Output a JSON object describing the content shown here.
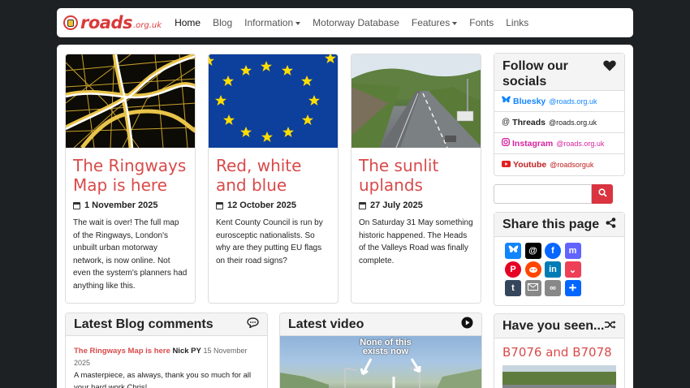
{
  "navbar": {
    "logo_text": "roads",
    "logo_suffix": ".org.uk",
    "items": [
      {
        "label": "Home",
        "active": true,
        "dropdown": false
      },
      {
        "label": "Blog",
        "active": false,
        "dropdown": false
      },
      {
        "label": "Information",
        "active": false,
        "dropdown": true
      },
      {
        "label": "Motorway Database",
        "active": false,
        "dropdown": false
      },
      {
        "label": "Features",
        "active": false,
        "dropdown": true
      },
      {
        "label": "Fonts",
        "active": false,
        "dropdown": false
      },
      {
        "label": "Links",
        "active": false,
        "dropdown": false
      }
    ]
  },
  "cards": [
    {
      "title": "The Ringways Map is here",
      "date": "1 November 2025",
      "text": "The wait is over! The full map of the Ringways, London's unbuilt urban motorway network, is now online. Not even the system's planners had anything like this."
    },
    {
      "title": "Red, white and blue",
      "date": "12 October 2025",
      "text": "Kent County Council is run by eurosceptic nationalists. So why are they putting EU flags on their road signs?"
    },
    {
      "title": "The sunlit uplands",
      "date": "27 July 2025",
      "text": "On Saturday 31 May something historic happened. The Heads of the Valleys Road was finally complete."
    }
  ],
  "socials": {
    "title": "Follow our socials",
    "icon": "heart-icon",
    "items": [
      {
        "name": "Bluesky",
        "handle": "@roads.org.uk",
        "color": "#1185fe",
        "icon": "butterfly-icon"
      },
      {
        "name": "Threads",
        "handle": "@roads.org.uk",
        "color": "#222222",
        "icon": "threads-icon"
      },
      {
        "name": "Instagram",
        "handle": "@roads.org.uk",
        "color": "#d6249f",
        "icon": "instagram-icon"
      },
      {
        "name": "Youtube",
        "handle": "@roadsorguk",
        "color": "#e02020",
        "icon": "youtube-icon"
      }
    ]
  },
  "search": {
    "placeholder": "",
    "button_icon": "search-icon"
  },
  "share": {
    "title": "Share this page",
    "icon": "share-icon",
    "buttons": [
      {
        "name": "bluesky",
        "color": "#1185fe"
      },
      {
        "name": "threads",
        "color": "#000000"
      },
      {
        "name": "facebook",
        "color": "#0866ff"
      },
      {
        "name": "mastodon",
        "color": "#6364ff"
      },
      {
        "name": "pinterest",
        "color": "#e60023"
      },
      {
        "name": "reddit",
        "color": "#ff4500"
      },
      {
        "name": "linkedin",
        "color": "#007bb5"
      },
      {
        "name": "pocket",
        "color": "#ee4056"
      },
      {
        "name": "tumblr",
        "color": "#35465c"
      },
      {
        "name": "email",
        "color": "#888888"
      },
      {
        "name": "copy-link",
        "color": "#888888"
      },
      {
        "name": "more",
        "color": "#0166ff"
      }
    ]
  },
  "blog_comments": {
    "title": "Latest Blog comments",
    "icon": "speech-bubble-icon",
    "comment": {
      "post": "The Ringways Map is here",
      "author": "Nick PY",
      "time": "15 November 2025",
      "text": "A masterpiece, as always, thank you so much for all your hard work Chris!"
    }
  },
  "video": {
    "title": "Latest video",
    "icon": "play-circle-icon",
    "overlay_text_1": "None of this",
    "overlay_text_2": "exists now"
  },
  "seen": {
    "title": "Have you seen...",
    "icon": "shuffle-icon",
    "item_title": "B7076 and B7078"
  },
  "colors": {
    "accent": "#d94a4a",
    "background": "#1e2124"
  }
}
